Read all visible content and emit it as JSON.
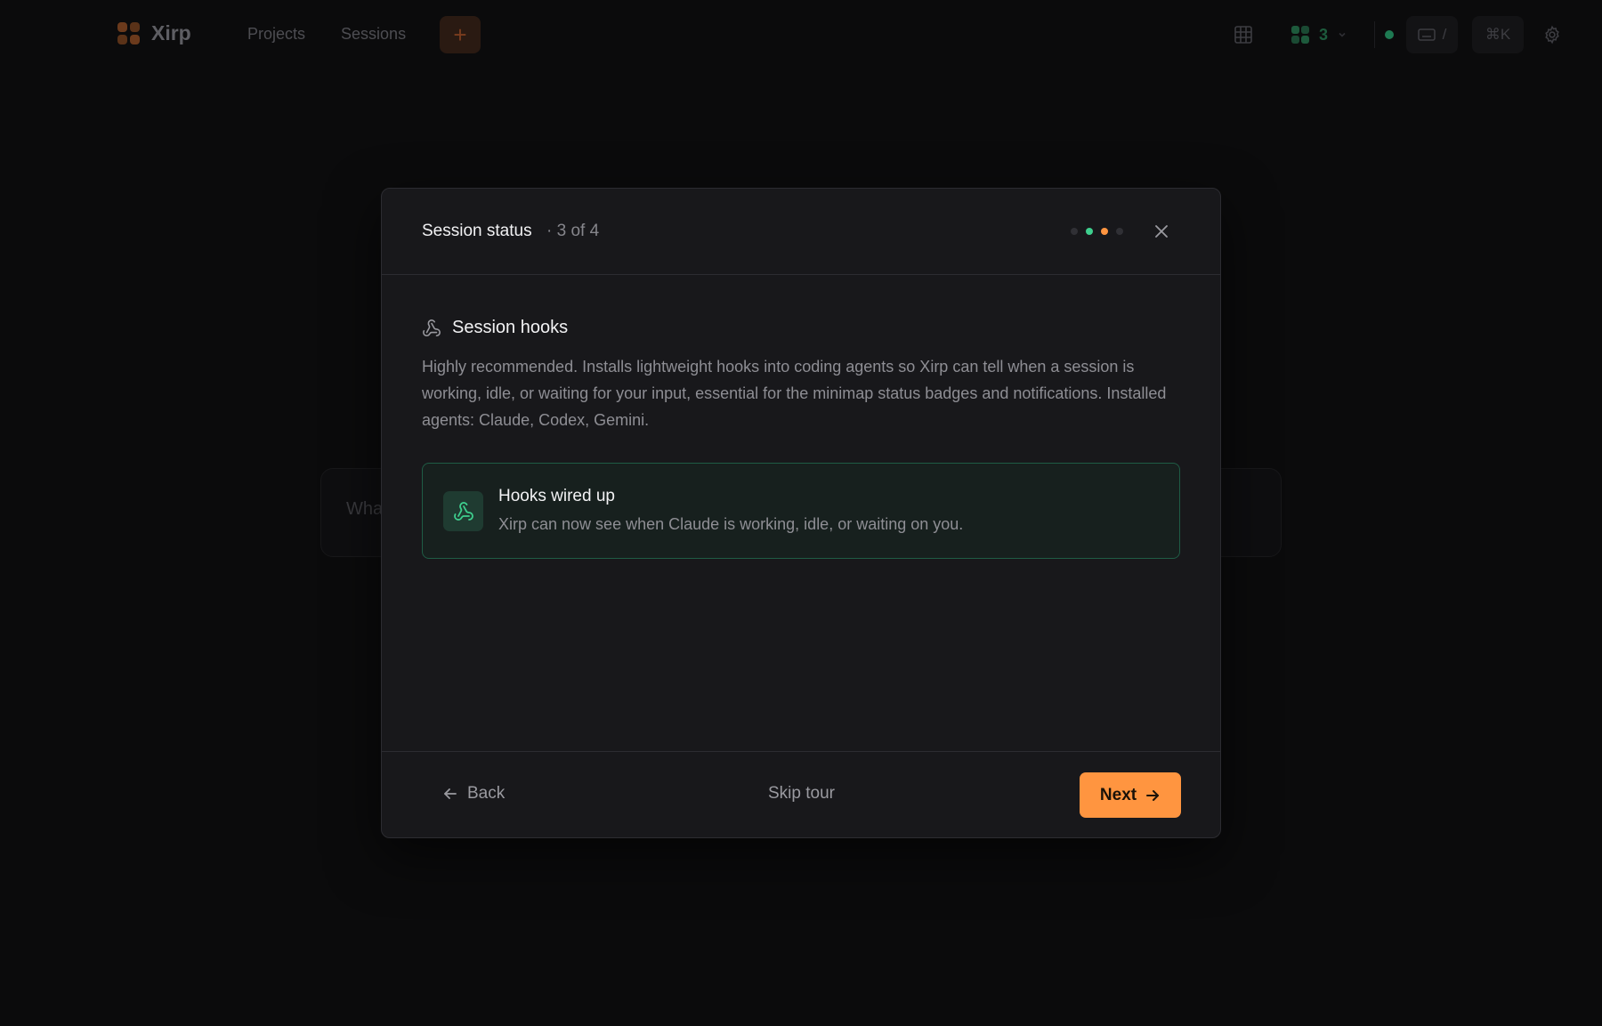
{
  "app": {
    "brand": "Xirp",
    "nav": [
      "Projects",
      "Sessions"
    ],
    "workspace_count": "3",
    "kb_shortcut": "/",
    "cmdk_shortcut": "⌘K",
    "input_placeholder": "Wha"
  },
  "modal": {
    "title": "Session status",
    "step": "· 3 of 4",
    "dots": [
      {
        "state": "inactive",
        "color": "#303035"
      },
      {
        "state": "done",
        "color": "#3ecf8e"
      },
      {
        "state": "current",
        "color": "#ff9540"
      },
      {
        "state": "inactive",
        "color": "#303035"
      }
    ],
    "section_title": "Session hooks",
    "section_icon": "webhook-icon",
    "description": "Highly recommended. Installs lightweight hooks into coding agents so Xirp can tell when a session is working, idle, or waiting for your input, essential for the minimap status badges and notifications. Installed agents: Claude, Codex, Gemini.",
    "status": {
      "title": "Hooks wired up",
      "text": "Xirp can now see when Claude is working, idle, or waiting on you.",
      "color": "#3ecf8e"
    },
    "footer": {
      "back_label": "Back",
      "skip_label": "Skip tour",
      "next_label": "Next"
    }
  },
  "colors": {
    "accent": "#ff9540",
    "success": "#3ecf8e"
  }
}
